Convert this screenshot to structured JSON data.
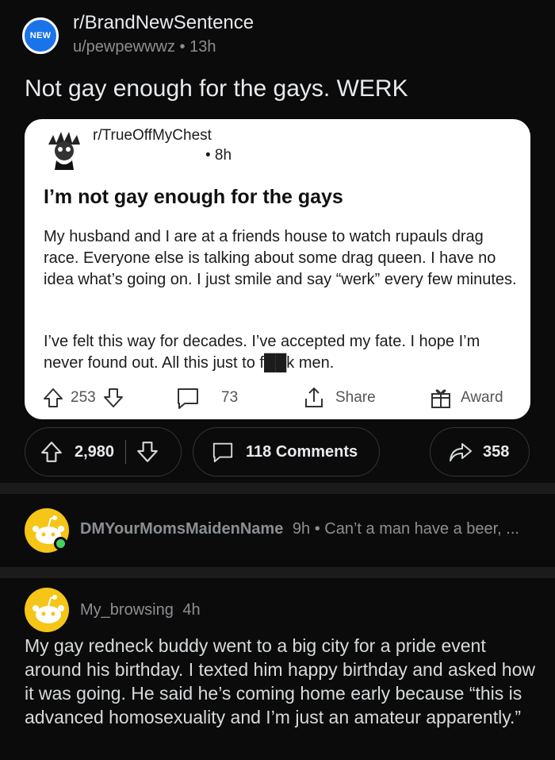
{
  "post": {
    "badge": "NEW",
    "subreddit": "r/BrandNewSentence",
    "user": "u/pewpewwwz",
    "age": "13h",
    "title": "Not gay enough for the gays. WERK",
    "upvotes": "2,980",
    "comments_label": "118 Comments",
    "shares": "358"
  },
  "embedded": {
    "subreddit": "r/TrueOffMyChest",
    "age": "• 8h",
    "title": "I’m not gay enough for the gays",
    "paragraph1": "My husband and I are at a friends house to watch rupauls drag race. Everyone else is talking about some drag queen. I have no idea what’s going on. I just smile and say “werk” every few minutes.",
    "paragraph2": "I’ve felt this way for decades. I’ve accepted my fate. I hope I’m never found out. All this just to f██k men.",
    "upvotes": "253",
    "comments": "73",
    "share_label": "Share",
    "award_label": "Award"
  },
  "comments": [
    {
      "user": "DMYourMomsMaidenName",
      "age": "9h",
      "preview": "• Can’t a man have a beer, ...",
      "online": true
    },
    {
      "user": "My_browsing",
      "age": "4h",
      "body": "My gay redneck buddy went to a big city for a pride event around his birthday.  I texted him happy birthday and asked how it was going.  He said he’s coming home early because “this is advanced homosexuality and I’m just an amateur apparently.”"
    }
  ],
  "colors": {
    "background": "#0b0b0b",
    "new_badge": "#1a73e8",
    "avatar_yellow": "#f5c518",
    "online_green": "#46d160"
  }
}
